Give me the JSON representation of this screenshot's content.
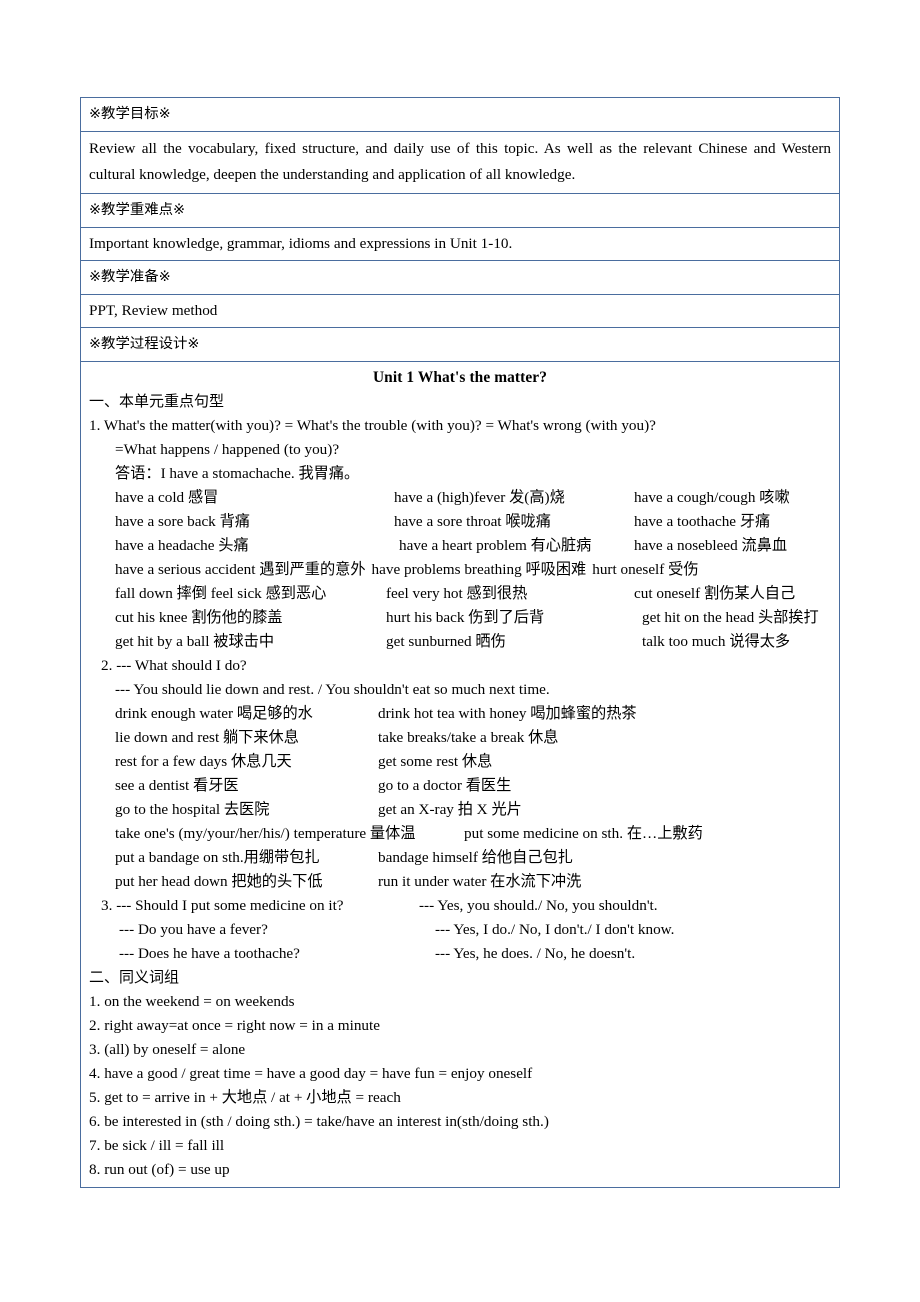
{
  "table": {
    "objective_header": "※教学目标※",
    "objective_body": "Review all the vocabulary, fixed structure, and daily use of this topic. As well as the relevant Chinese and Western cultural knowledge, deepen the understanding and application of all knowledge.",
    "key_points_header": "※教学重难点※",
    "key_points_body": "Important knowledge, grammar, idioms and expressions in Unit 1-10.",
    "preparation_header": "※教学准备※",
    "preparation_body": "PPT, Review method",
    "process_header": "※教学过程设计※"
  },
  "unit": {
    "title": "Unit 1 What's the matter?",
    "section_one_heading": "一、本单元重点句型",
    "item1": {
      "number": "1.",
      "line1": "What's the matter(with you)? = What's the trouble (with you)? = What's wrong (with you)?",
      "line2": "=What happens / happened (to you)?",
      "line3": "答语：I have a stomachache.  我胃痛。"
    },
    "symptom_rows": [
      [
        "have a cold  感冒",
        "have a (high)fever  发(高)烧",
        "have a cough/cough  咳嗽"
      ],
      [
        "have a sore back 背痛",
        "have a sore throat  喉咙痛",
        "have a toothache 牙痛"
      ],
      [
        "have a headache  头痛",
        "have a heart problem 有心脏病",
        "have a nosebleed 流鼻血"
      ]
    ],
    "symptom_flow_row": [
      "have a serious accident 遇到严重的意外",
      "have problems breathing  呼吸困难",
      "hurt oneself  受伤"
    ],
    "injury_rows": [
      [
        "fall down  摔倒  feel sick  感到恶心",
        "feel very hot  感到很热",
        "cut oneself  割伤某人自己"
      ],
      [
        "cut his knee  割伤他的膝盖",
        "hurt his back  伤到了后背",
        "get hit on the head  头部挨打"
      ],
      [
        "get hit by a ball  被球击中",
        "get sunburned  晒伤",
        "talk too much  说得太多"
      ]
    ],
    "item2": {
      "number": "2.",
      "question": "--- What should I do?",
      "answer": "--- You should lie down and rest. / You shouldn't eat so much next time."
    },
    "advice_rows": [
      [
        "drink enough water  喝足够的水",
        "drink hot tea with honey  喝加蜂蜜的热茶"
      ],
      [
        "lie down and rest  躺下来休息",
        "take breaks/take a break  休息"
      ],
      [
        "rest for a few days  休息几天",
        "get some rest  休息"
      ],
      [
        "see a dentist  看牙医",
        "go to a doctor  看医生"
      ],
      [
        "go to the hospital  去医院",
        "get an X-ray  拍 X  光片"
      ],
      [
        "take one's (my/your/her/his/) temperature  量体温",
        "put some medicine on sth.  在…上敷药"
      ],
      [
        "put a bandage on sth.用绷带包扎",
        "bandage himself  给他自己包扎"
      ],
      [
        "put her head down  把她的头下低",
        "run it under water  在水流下冲洗"
      ]
    ],
    "item3": {
      "number": "3.",
      "qa": [
        [
          "--- Should I put some medicine on it?",
          "--- Yes, you should./ No, you shouldn't."
        ],
        [
          "--- Do you have a fever?",
          "--- Yes, I do./ No, I don't./ I don't know."
        ],
        [
          "--- Does he have a toothache?",
          "--- Yes, he does. / No, he doesn't."
        ]
      ]
    },
    "section_two_heading": "二、同义词组",
    "synonyms": [
      "1. on the weekend = on weekends",
      "2. right away=at once = right now = in a minute",
      "3. (all) by oneself = alone",
      "4. have a good / great time = have a good day = have fun = enjoy oneself",
      "5. get to = arrive in +  大地点  / at +  小地点  = reach",
      "6. be interested in (sth / doing sth.) = take/have an interest in(sth/doing sth.)",
      "7. be sick / ill = fall ill",
      "8. run out (of) = use up"
    ]
  }
}
